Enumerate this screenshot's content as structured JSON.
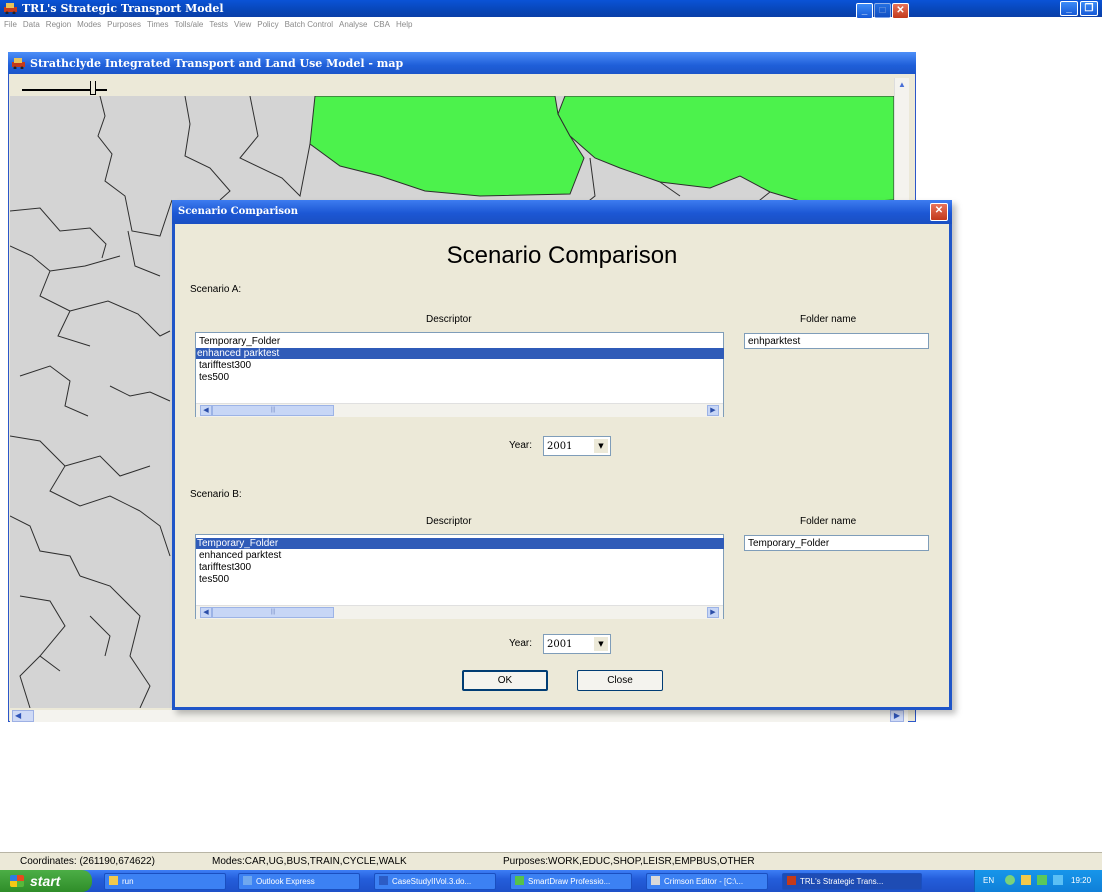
{
  "app": {
    "title": "TRL's Strategic Transport Model",
    "menu": [
      "File",
      "Data",
      "Region",
      "Modes",
      "Purposes",
      "Times",
      "Tolls/ale",
      "Tests",
      "View",
      "Policy",
      "Batch Control",
      "Analyse",
      "CBA",
      "Help"
    ]
  },
  "map_window": {
    "title": "Strathclyde Integrated Transport and Land Use Model - map",
    "colors": {
      "zone_fill": "#d4d4d4",
      "highlight_fill": "#4cf24c",
      "border": "#2e2e2e"
    }
  },
  "dialog": {
    "title": "Scenario Comparison",
    "heading": "Scenario Comparison",
    "scenario_a": {
      "label": "Scenario A:",
      "descriptor_header": "Descriptor",
      "folder_header": "Folder name",
      "items": [
        "Temporary_Folder",
        "enhanced parktest",
        "tarifftest300",
        "tes500"
      ],
      "selected_index": 1,
      "folder_value": "enhparktest",
      "year_label": "Year:",
      "year_value": "2001"
    },
    "scenario_b": {
      "label": "Scenario B:",
      "descriptor_header": "Descriptor",
      "folder_header": "Folder name",
      "items": [
        "Temporary_Folder",
        "enhanced parktest",
        "tarifftest300",
        "tes500"
      ],
      "selected_index": 0,
      "folder_value": "Temporary_Folder",
      "year_label": "Year:",
      "year_value": "2001"
    },
    "ok_label": "OK",
    "close_label": "Close"
  },
  "statusbar": {
    "coordinates": "Coordinates: (261190,674622)",
    "modes": "Modes:CAR,UG,BUS,TRAIN,CYCLE,WALK",
    "purposes": "Purposes:WORK,EDUC,SHOP,LEISR,EMPBUS,OTHER"
  },
  "taskbar": {
    "start_label": "start",
    "tasks": [
      "run",
      "Outlook Express",
      "CaseStudyIIVol.3.do...",
      "SmartDraw Professio...",
      "Crimson Editor - [C:\\...",
      "TRL's Strategic Trans..."
    ],
    "tray_lang": "EN",
    "clock": "19:20"
  }
}
